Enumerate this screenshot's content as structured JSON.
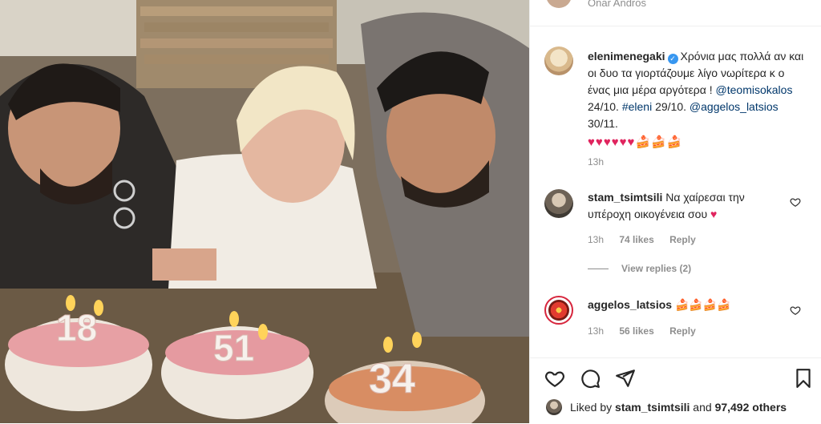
{
  "top": {
    "name": "Onar Andros"
  },
  "caption": {
    "username": "elenimenegaki",
    "verified_mark": "✓",
    "text_1": "Χρόνια μας πολλά αν και οι δυο τα γιορτάζουμε λίγο νωρίτερα κ ο ένας μια μέρα αργότερα ! ",
    "mention_1": "@teomisokalos",
    "text_2": " 24/10. ",
    "hashtag": "#eleni",
    "text_3": " 29/10. ",
    "mention_2": "@aggelos_latsios",
    "text_4": " 30/11.",
    "hearts": "♥♥♥♥♥♥",
    "cakes": "🍰🍰🍰",
    "time": "13h"
  },
  "comments": [
    {
      "username": "stam_tsimtsili",
      "text": "Να χαίρεσαι την υπέροχη οικογένεια σου",
      "emoji": "♥",
      "time": "13h",
      "likes": "74 likes",
      "reply": "Reply"
    },
    {
      "username": "aggelos_latsios",
      "text": "",
      "emoji": "🍰🍰🍰🍰",
      "time": "13h",
      "likes": "56 likes",
      "reply": "Reply"
    }
  ],
  "view_replies": "View replies (2)",
  "likes_line": {
    "prefix": "Liked by ",
    "user": "stam_tsimtsili",
    "middle": " and ",
    "count": "97,492 others"
  },
  "photo": {
    "candles_1": "18",
    "candles_2": "51",
    "candles_3": "34"
  },
  "icons": [
    "heart-icon",
    "comment-icon",
    "share-icon",
    "bookmark-icon"
  ],
  "colors": {
    "mention": "#00376b",
    "verified": "#3897f0",
    "heart": "#e0245e",
    "meta": "#8e8e8e"
  }
}
